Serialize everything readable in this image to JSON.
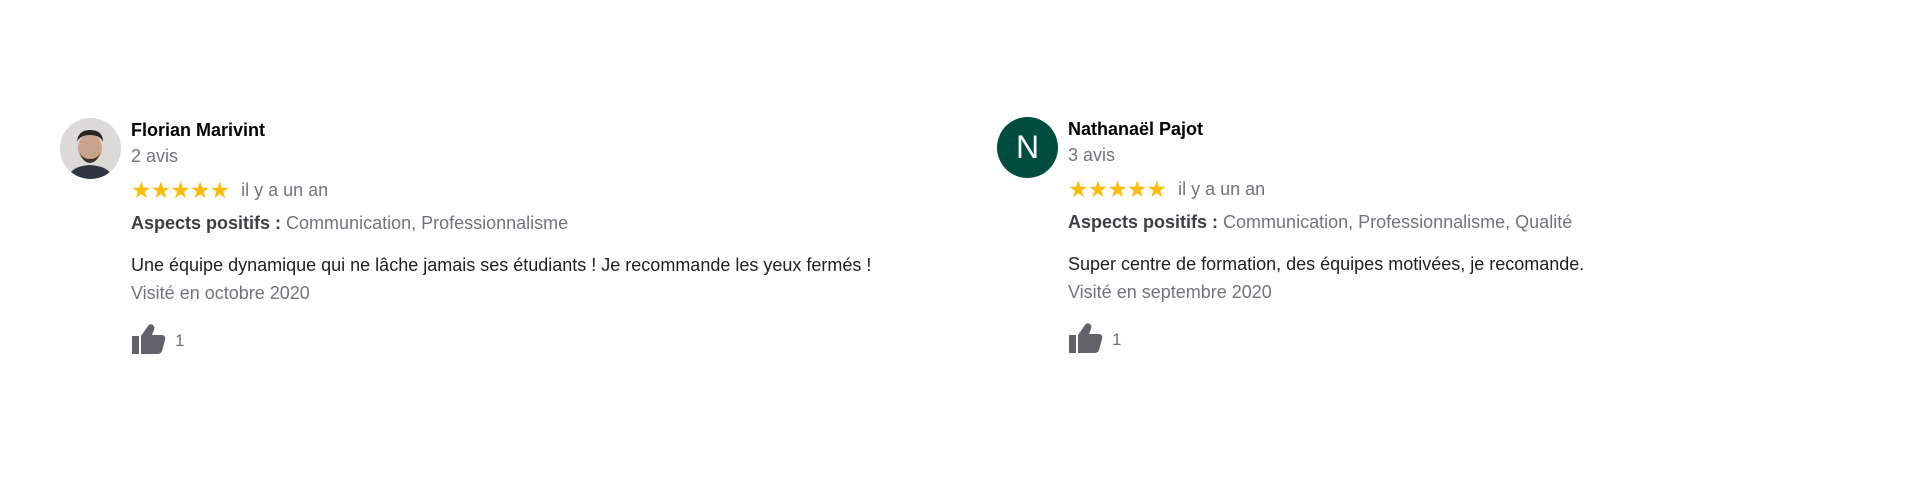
{
  "colors": {
    "star": "#fbbc04",
    "muted": "#70757a",
    "avatar_letter_bg": "#004d40"
  },
  "reviews": [
    {
      "author": "Florian Marivint",
      "count": "2 avis",
      "avatar_type": "photo",
      "rating": 5,
      "stars": "★★★★★",
      "date": "il y a un an",
      "aspects_label": "Aspects positifs :",
      "aspects_values": "Communication, Professionnalisme",
      "text": "Une équipe dynamique qui ne lâche jamais ses étudiants ! Je recommande les yeux fermés !",
      "visited": "Visité en octobre 2020",
      "like_icon": "thumbs-up-icon",
      "likes": "1"
    },
    {
      "author": "Nathanaël Pajot",
      "count": "3 avis",
      "avatar_type": "letter",
      "avatar_letter": "N",
      "rating": 5,
      "stars": "★★★★★",
      "date": "il y a un an",
      "aspects_label": "Aspects positifs :",
      "aspects_values": "Communication, Professionnalisme, Qualité",
      "text": "Super centre de formation, des équipes motivées, je recomande.",
      "visited": "Visité en septembre 2020",
      "like_icon": "thumbs-up-icon",
      "likes": "1"
    }
  ]
}
